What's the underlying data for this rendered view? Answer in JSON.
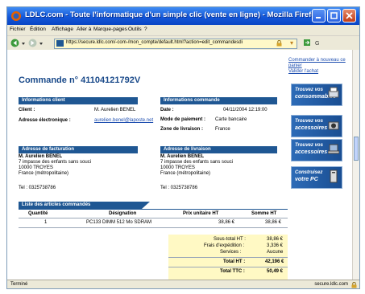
{
  "window": {
    "title": "LDLC.com - Toute l'informatique d'un simple clic (vente en ligne) - Mozilla Firefox"
  },
  "menu": [
    "Fichier",
    "Édition",
    "Affichage",
    "Aller à",
    "Marque-pages",
    "Outils",
    "?"
  ],
  "toolbar": {
    "url": "https://secure.ldlc.com/-com-/mon_compte/default.html?action=edit_commandesdi"
  },
  "page": {
    "order_title": "Commande n° 41104121792V",
    "side_link": [
      "Commander à nouveau ce panier",
      "Valider l'achat"
    ],
    "client": {
      "header": "Informations client",
      "client_label": "Client :",
      "client_value": "M. Aurelien BENEL",
      "email_label": "Adresse électronique :",
      "email_value": "aurelien.benel@laposte.net"
    },
    "commande": {
      "header": "Informations commande",
      "date_label": "Date :",
      "date_value": "04/11/2004 12:19:00",
      "payment_label": "Mode de paiement :",
      "payment_value": "Carte bancaire",
      "zone_label": "Zone de livraison :",
      "zone_value": "France"
    },
    "facturation": {
      "header": "Adresse de facturation",
      "name": "M. Aurelien BENEL",
      "line1": "7 impasse des enfants sans souci",
      "line2": "10000 TROYES",
      "line3": "France (métropolitaine)",
      "tel": "Tel : 0325738786"
    },
    "livraison": {
      "header": "Adresse de livraison",
      "name": "M. Aurelien BENEL",
      "line1": "7 impasse des enfants sans souci",
      "line2": "10000 TROYES",
      "line3": "France (métropolitaine)",
      "tel": "Tel : 0325738786"
    },
    "articles": {
      "header": "Liste des articles commandés",
      "columns": [
        "Quantité",
        "Désignation",
        "Prix unitaire HT",
        "Somme HT"
      ],
      "rows": [
        {
          "qty": "1",
          "designation": "PC133 DIMM 512 Mo SDRAM",
          "unit": "38,86 €",
          "sum": "38,86 €"
        }
      ]
    },
    "totals": {
      "subtotal_label": "Sous-total HT :",
      "subtotal_value": "38,86 €",
      "shipping_label": "Frais d'expédition :",
      "shipping_value": "3,336 €",
      "services_label": "Services :",
      "services_value": "Aucune",
      "total_ht_label": "Total HT :",
      "total_ht_value": "42,196 €",
      "total_ttc_label": "Total TTC :",
      "total_ttc_value": "50,49 €"
    },
    "promos": [
      {
        "l1": "Trouvez vos",
        "l2": "consommables"
      },
      {
        "l1": "Trouvez vos",
        "l2": "accessoires"
      },
      {
        "l1": "Trouvez vos",
        "l2": "accessoires"
      },
      {
        "l1": "Construisez",
        "l2": "votre PC"
      }
    ]
  },
  "status": {
    "left": "Terminé",
    "right": "secure.ldlc.com"
  },
  "colors": {
    "header_blue": "#1f5793",
    "totals_yellow": "#fff9c4"
  }
}
